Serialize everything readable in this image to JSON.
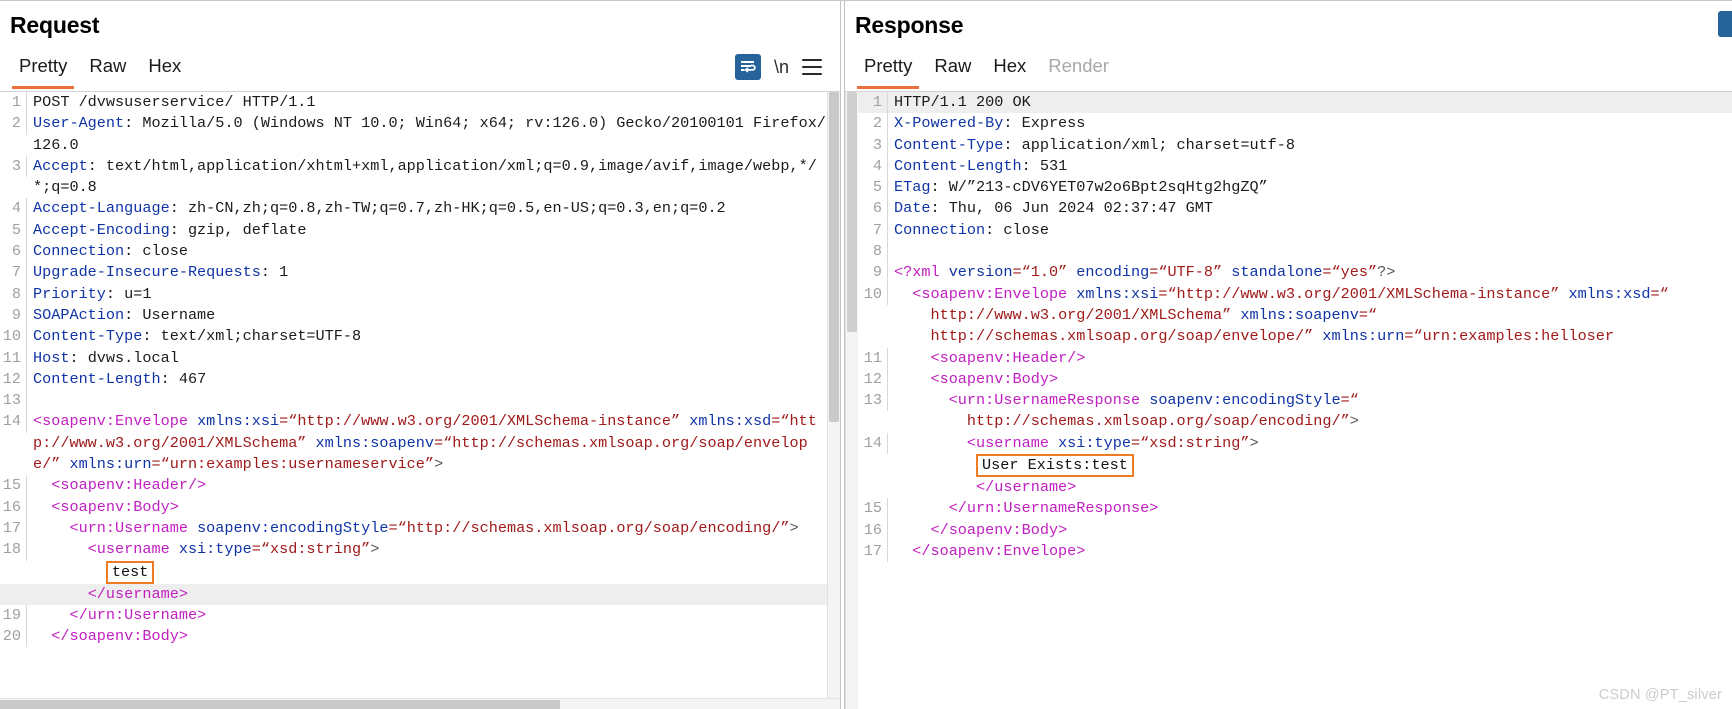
{
  "request": {
    "title": "Request",
    "tabs": [
      {
        "label": "Pretty",
        "active": true,
        "disabled": false
      },
      {
        "label": "Raw",
        "active": false,
        "disabled": false
      },
      {
        "label": "Hex",
        "active": false,
        "disabled": false
      }
    ],
    "tools": {
      "wrap_icon": "word-wrap-icon",
      "newline_label": "\\n",
      "menu_icon": "hamburger-menu-icon"
    },
    "lines": [
      {
        "n": "1",
        "segs": [
          {
            "t": "POST /dvwsuserservice/ HTTP/1.1",
            "c": "k-plain"
          }
        ]
      },
      {
        "n": "2",
        "segs": [
          {
            "t": "User-Agent",
            "c": "k-hdr"
          },
          {
            "t": ": Mozilla/5.0 (Windows NT 10.0; Win64; x64; rv:126.0) Gecko/20100101 Firefox/126.0",
            "c": "k-plain"
          }
        ]
      },
      {
        "n": "3",
        "segs": [
          {
            "t": "Accept",
            "c": "k-hdr"
          },
          {
            "t": ": text/html,application/xhtml+xml,application/xml;q=0.9,image/avif,image/webp,*/*;q=0.8",
            "c": "k-plain"
          }
        ]
      },
      {
        "n": "4",
        "segs": [
          {
            "t": "Accept-Language",
            "c": "k-hdr"
          },
          {
            "t": ": zh-CN,zh;q=0.8,zh-TW;q=0.7,zh-HK;q=0.5,en-US;q=0.3,en;q=0.2",
            "c": "k-plain"
          }
        ]
      },
      {
        "n": "5",
        "segs": [
          {
            "t": "Accept-Encoding",
            "c": "k-hdr"
          },
          {
            "t": ": gzip, deflate",
            "c": "k-plain"
          }
        ]
      },
      {
        "n": "6",
        "segs": [
          {
            "t": "Connection",
            "c": "k-hdr"
          },
          {
            "t": ": close",
            "c": "k-plain"
          }
        ]
      },
      {
        "n": "7",
        "segs": [
          {
            "t": "Upgrade-Insecure-Requests",
            "c": "k-hdr"
          },
          {
            "t": ": 1",
            "c": "k-plain"
          }
        ]
      },
      {
        "n": "8",
        "segs": [
          {
            "t": "Priority",
            "c": "k-hdr"
          },
          {
            "t": ": u=1",
            "c": "k-plain"
          }
        ]
      },
      {
        "n": "9",
        "segs": [
          {
            "t": "SOAPAction",
            "c": "k-hdr"
          },
          {
            "t": ": Username",
            "c": "k-plain"
          }
        ]
      },
      {
        "n": "10",
        "segs": [
          {
            "t": "Content-Type",
            "c": "k-hdr"
          },
          {
            "t": ": text/xml;charset=UTF-8",
            "c": "k-plain"
          }
        ]
      },
      {
        "n": "11",
        "segs": [
          {
            "t": "Host",
            "c": "k-hdr"
          },
          {
            "t": ": dvws.local",
            "c": "k-plain"
          }
        ]
      },
      {
        "n": "12",
        "segs": [
          {
            "t": "Content-Length",
            "c": "k-hdr"
          },
          {
            "t": ": 467",
            "c": "k-plain"
          }
        ]
      },
      {
        "n": "13",
        "segs": [
          {
            "t": "",
            "c": "k-plain"
          }
        ]
      },
      {
        "n": "14",
        "segs": [
          {
            "t": "<soapenv:Envelope",
            "c": "k-tag"
          },
          {
            "t": " xmlns:xsi",
            "c": "k-attr"
          },
          {
            "t": "=“http://www.w3.org/2001/XMLSchema-instance”",
            "c": "k-val"
          },
          {
            "t": " xmlns:xsd",
            "c": "k-attr"
          },
          {
            "t": "=“http://www.w3.org/2001/XMLSchema”",
            "c": "k-val"
          },
          {
            "t": " xmlns:soapenv",
            "c": "k-attr"
          },
          {
            "t": "=“http://schemas.xmlsoap.org/soap/envelope/”",
            "c": "k-val"
          },
          {
            "t": " xmlns:urn",
            "c": "k-attr"
          },
          {
            "t": "=“urn:examples:usernameservice”",
            "c": "k-val"
          },
          {
            "t": ">",
            "c": "k-punc"
          }
        ]
      },
      {
        "n": "15",
        "segs": [
          {
            "t": "  ",
            "c": "k-plain"
          },
          {
            "t": "<soapenv:Header/>",
            "c": "k-tag"
          }
        ]
      },
      {
        "n": "16",
        "segs": [
          {
            "t": "  ",
            "c": "k-plain"
          },
          {
            "t": "<soapenv:Body>",
            "c": "k-tag"
          }
        ]
      },
      {
        "n": "17",
        "segs": [
          {
            "t": "    ",
            "c": "k-plain"
          },
          {
            "t": "<urn:Username",
            "c": "k-tag"
          },
          {
            "t": " soapenv:encodingStyle",
            "c": "k-attr"
          },
          {
            "t": "=“http://schemas.xmlsoap.org/soap/encoding/”",
            "c": "k-val"
          },
          {
            "t": ">",
            "c": "k-punc"
          }
        ]
      },
      {
        "n": "18",
        "segs": [
          {
            "t": "      ",
            "c": "k-plain"
          },
          {
            "t": "<username",
            "c": "k-tag"
          },
          {
            "t": " xsi:type",
            "c": "k-attr"
          },
          {
            "t": "=“xsd:string”",
            "c": "k-val"
          },
          {
            "t": ">",
            "c": "k-punc"
          }
        ]
      },
      {
        "n": "",
        "boxed": "test",
        "indent": "        "
      },
      {
        "n": "",
        "hl": true,
        "segs": [
          {
            "t": "      ",
            "c": "k-plain"
          },
          {
            "t": "</username>",
            "c": "k-tag"
          }
        ]
      },
      {
        "n": "19",
        "segs": [
          {
            "t": "    ",
            "c": "k-plain"
          },
          {
            "t": "</urn:Username>",
            "c": "k-tag"
          }
        ]
      },
      {
        "n": "20",
        "segs": [
          {
            "t": "  ",
            "c": "k-plain"
          },
          {
            "t": "</soapenv:Body>",
            "c": "k-tag"
          }
        ]
      }
    ]
  },
  "response": {
    "title": "Response",
    "tabs": [
      {
        "label": "Pretty",
        "active": true,
        "disabled": false
      },
      {
        "label": "Raw",
        "active": false,
        "disabled": false
      },
      {
        "label": "Hex",
        "active": false,
        "disabled": false
      },
      {
        "label": "Render",
        "active": false,
        "disabled": true
      }
    ],
    "lines": [
      {
        "n": "1",
        "hl": true,
        "segs": [
          {
            "t": "HTTP/1.1 200 OK",
            "c": "k-plain"
          }
        ]
      },
      {
        "n": "2",
        "segs": [
          {
            "t": "X-Powered-By",
            "c": "k-hdr"
          },
          {
            "t": ": Express",
            "c": "k-plain"
          }
        ]
      },
      {
        "n": "3",
        "segs": [
          {
            "t": "Content-Type",
            "c": "k-hdr"
          },
          {
            "t": ": application/xml; charset=utf-8",
            "c": "k-plain"
          }
        ]
      },
      {
        "n": "4",
        "segs": [
          {
            "t": "Content-Length",
            "c": "k-hdr"
          },
          {
            "t": ": 531",
            "c": "k-plain"
          }
        ]
      },
      {
        "n": "5",
        "segs": [
          {
            "t": "ETag",
            "c": "k-hdr"
          },
          {
            "t": ": W/”213-cDV6YET07w2o6Bpt2sqHtg2hgZQ”",
            "c": "k-plain"
          }
        ]
      },
      {
        "n": "6",
        "segs": [
          {
            "t": "Date",
            "c": "k-hdr"
          },
          {
            "t": ": Thu, 06 Jun 2024 02:37:47 GMT",
            "c": "k-plain"
          }
        ]
      },
      {
        "n": "7",
        "segs": [
          {
            "t": "Connection",
            "c": "k-hdr"
          },
          {
            "t": ": close",
            "c": "k-plain"
          }
        ]
      },
      {
        "n": "8",
        "segs": [
          {
            "t": "",
            "c": "k-plain"
          }
        ]
      },
      {
        "n": "9",
        "segs": [
          {
            "t": "<?xml",
            "c": "k-tag"
          },
          {
            "t": " version",
            "c": "k-attr"
          },
          {
            "t": "=“1.0”",
            "c": "k-val"
          },
          {
            "t": " encoding",
            "c": "k-attr"
          },
          {
            "t": "=“UTF-8”",
            "c": "k-val"
          },
          {
            "t": " standalone",
            "c": "k-attr"
          },
          {
            "t": "=“yes”",
            "c": "k-val"
          },
          {
            "t": "?>",
            "c": "k-punc"
          }
        ]
      },
      {
        "n": "10",
        "segs": [
          {
            "t": "  ",
            "c": "k-plain"
          },
          {
            "t": "<soapenv:Envelope",
            "c": "k-tag"
          },
          {
            "t": " xmlns:xsi",
            "c": "k-attr"
          },
          {
            "t": "=“http://www.w3.org/2001/XMLSchema-instance”",
            "c": "k-val"
          },
          {
            "t": " xmlns:xsd",
            "c": "k-attr"
          },
          {
            "t": "=“",
            "c": "k-val"
          }
        ]
      },
      {
        "n": "",
        "segs": [
          {
            "t": "    ",
            "c": "k-plain"
          },
          {
            "t": "http://www.w3.org/2001/XMLSchema”",
            "c": "k-val"
          },
          {
            "t": " xmlns:soapenv",
            "c": "k-attr"
          },
          {
            "t": "=“",
            "c": "k-val"
          }
        ]
      },
      {
        "n": "",
        "segs": [
          {
            "t": "    ",
            "c": "k-plain"
          },
          {
            "t": "http://schemas.xmlsoap.org/soap/envelope/”",
            "c": "k-val"
          },
          {
            "t": " xmlns:urn",
            "c": "k-attr"
          },
          {
            "t": "=“urn:examples:helloser",
            "c": "k-val"
          }
        ]
      },
      {
        "n": "11",
        "segs": [
          {
            "t": "    ",
            "c": "k-plain"
          },
          {
            "t": "<soapenv:Header/>",
            "c": "k-tag"
          }
        ]
      },
      {
        "n": "12",
        "segs": [
          {
            "t": "    ",
            "c": "k-plain"
          },
          {
            "t": "<soapenv:Body>",
            "c": "k-tag"
          }
        ]
      },
      {
        "n": "13",
        "segs": [
          {
            "t": "      ",
            "c": "k-plain"
          },
          {
            "t": "<urn:UsernameResponse",
            "c": "k-tag"
          },
          {
            "t": " soapenv:encodingStyle",
            "c": "k-attr"
          },
          {
            "t": "=“",
            "c": "k-val"
          }
        ]
      },
      {
        "n": "",
        "segs": [
          {
            "t": "        ",
            "c": "k-plain"
          },
          {
            "t": "http://schemas.xmlsoap.org/soap/encoding/”",
            "c": "k-val"
          },
          {
            "t": ">",
            "c": "k-punc"
          }
        ]
      },
      {
        "n": "14",
        "segs": [
          {
            "t": "        ",
            "c": "k-plain"
          },
          {
            "t": "<username",
            "c": "k-tag"
          },
          {
            "t": " xsi:type",
            "c": "k-attr"
          },
          {
            "t": "=“xsd:string”",
            "c": "k-val"
          },
          {
            "t": ">",
            "c": "k-punc"
          }
        ]
      },
      {
        "n": "",
        "boxed": "User Exists:test",
        "indent": "         "
      },
      {
        "n": "",
        "segs": [
          {
            "t": "         ",
            "c": "k-plain"
          },
          {
            "t": "</username>",
            "c": "k-tag"
          }
        ]
      },
      {
        "n": "15",
        "segs": [
          {
            "t": "      ",
            "c": "k-plain"
          },
          {
            "t": "</urn:UsernameResponse>",
            "c": "k-tag"
          }
        ]
      },
      {
        "n": "16",
        "segs": [
          {
            "t": "    ",
            "c": "k-plain"
          },
          {
            "t": "</soapenv:Body>",
            "c": "k-tag"
          }
        ]
      },
      {
        "n": "17",
        "segs": [
          {
            "t": "  ",
            "c": "k-plain"
          },
          {
            "t": "</soapenv:Envelope>",
            "c": "k-tag"
          }
        ]
      }
    ]
  },
  "watermark": "CSDN @PT_silver",
  "colors": {
    "accent_orange": "#e8703a",
    "highlight_box": "#ef7c22",
    "icon_blue": "#27639b",
    "tag_purple": "#c11fc1",
    "attr_blue": "#1034a6",
    "value_red": "#a01a1a"
  }
}
